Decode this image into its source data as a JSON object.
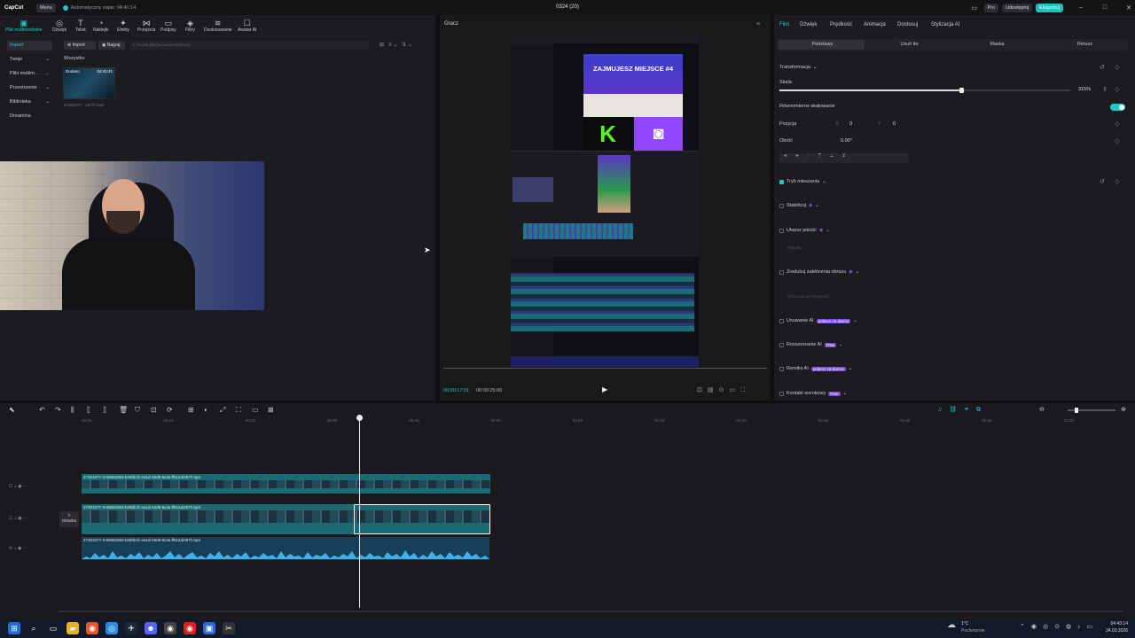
{
  "app": {
    "logo": "CapCut",
    "menu": "Menu",
    "autosave": "Automatyczny zapis: 04:41:14",
    "project_title": "0324 (20)",
    "pro": "Pro",
    "share": "Udostępnij",
    "export": "Eksportuj"
  },
  "toolbar": [
    {
      "label": "Pliki multimedialne",
      "icon": "media-icon",
      "glyph": "▣"
    },
    {
      "label": "Dźwięk",
      "icon": "audio-icon",
      "glyph": "◎"
    },
    {
      "label": "Tekst",
      "icon": "text-icon",
      "glyph": "T"
    },
    {
      "label": "Naklejki",
      "icon": "sticker-icon",
      "glyph": "◔"
    },
    {
      "label": "Efekty",
      "icon": "effects-icon",
      "glyph": "✦"
    },
    {
      "label": "Przejścia",
      "icon": "transition-icon",
      "glyph": "⋈"
    },
    {
      "label": "Podpisy",
      "icon": "captions-icon",
      "glyph": "▭"
    },
    {
      "label": "Filtry",
      "icon": "filters-icon",
      "glyph": "◈"
    },
    {
      "label": "Dostosowanie",
      "icon": "adjust-icon",
      "glyph": "≋"
    },
    {
      "label": "Awatar AI",
      "icon": "avatar-icon",
      "glyph": "☐"
    }
  ],
  "sidebar": {
    "items": [
      {
        "label": "Import",
        "arrow": ""
      },
      {
        "label": "Twoje",
        "arrow": "⌄"
      },
      {
        "label": "Pliki multim…",
        "arrow": "→"
      },
      {
        "label": "Przestrzenie",
        "arrow": "⌄"
      },
      {
        "label": "Biblioteka",
        "arrow": "⌄"
      },
      {
        "label": "Dreamina",
        "arrow": ""
      }
    ]
  },
  "media": {
    "import_btn": "Import",
    "record_btn": "Nagraj",
    "search_placeholder": "Szukaj plików multimedialnych",
    "filter_all": "Wszystko",
    "added": "Dodano",
    "duration": "04:42:41",
    "filename": "27301077...A877f.mp4"
  },
  "player": {
    "title": "Gracz",
    "time_current": "00:00:17:01",
    "time_total": "00:00:25:00",
    "overlay_text": "ZAJMUJESZ MIEJSCE #4"
  },
  "right_panel": {
    "tabs": [
      "Film",
      "Dźwięk",
      "Prędkość",
      "Animacja",
      "Dostosuj",
      "Stylizacja AI"
    ],
    "subtabs": [
      "Podstawy",
      "Usuń tło",
      "Maska",
      "Retusz"
    ],
    "transform": "Transformacja",
    "scale": "Skala",
    "scale_value": "315%",
    "uniform_scale": "Równomierne skalowanie",
    "position": "Pozycja",
    "pos_x_label": "X",
    "pos_x": "0",
    "pos_y_label": "Y",
    "pos_y": "0",
    "rotate": "Obróć",
    "rotate_value": "0.00°",
    "blend": "Tryb mieszania",
    "stabilize": "Stabilizuj",
    "enhance": "Ulepsz jakość",
    "enhance_sub": "Popraw",
    "denoise": "Zredukuj zakłócenia obrazu",
    "denoise_sub": "Optyczna przystępność",
    "ai_remove": "Usuwanie AI",
    "ai_remove_badge": "pobierz za darmo",
    "ai_expand": "Rozszerzanie AI",
    "ai_expand_badge": "Free",
    "ai_remix": "Remiks AI",
    "ai_remix_badge": "pobierz za darmo",
    "contact": "Kontakt wzrokowy",
    "contact_badge": "Free"
  },
  "timeline": {
    "ruler": [
      "00:00",
      "00:10",
      "00:20",
      "00:30",
      "00:40",
      "00:50",
      "01:00",
      "01:10",
      "01:20",
      "01:30",
      "01:40",
      "01:50",
      "02:00",
      "02:10"
    ],
    "cover": "Okładka",
    "clip_name": "27301077-3-69902083-b49fdcfc-ea1d-45d9-8cda-ff8c2af487f.mp4",
    "clip_short": "2730107"
  },
  "taskbar": {
    "weather_temp": "1°C",
    "weather_desc": "Pochmurnie",
    "time": "04:43:14",
    "date": "24.03.2026"
  }
}
